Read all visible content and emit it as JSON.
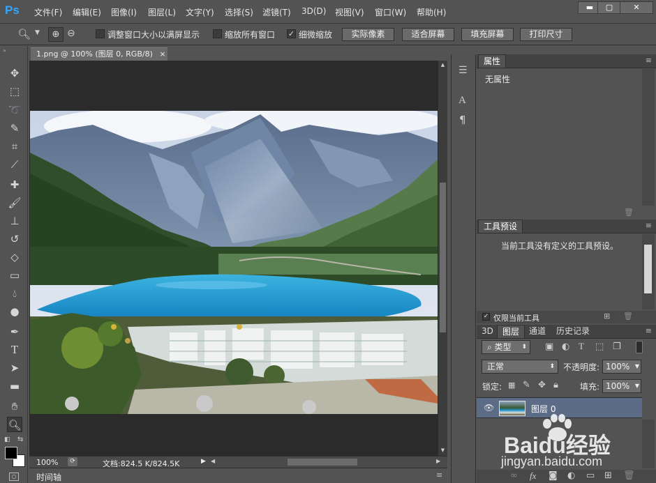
{
  "app": {
    "logo": "Ps"
  },
  "menu": [
    "文件(F)",
    "编辑(E)",
    "图像(I)",
    "图层(L)",
    "文字(Y)",
    "选择(S)",
    "滤镜(T)",
    "3D(D)",
    "视图(V)",
    "窗口(W)",
    "帮助(H)"
  ],
  "window_controls": {
    "minimize": "▬",
    "maximize": "▢",
    "close": "✕"
  },
  "options": {
    "resize_windows": "调整窗口大小以满屏显示",
    "zoom_all_windows": "缩放所有窗口",
    "scrubby_zoom": "细微缩放",
    "scrubby_zoom_checked": "✓",
    "actual_pixels": "实际像素",
    "fit_screen": "适合屏幕",
    "fill_screen": "填充屏幕",
    "print_size": "打印尺寸"
  },
  "document": {
    "tab_title": "1.png @ 100% (图层 0, RGB/8)",
    "close": "×"
  },
  "status": {
    "zoom": "100%",
    "doc_info": "文档:824.5 K/824.5K"
  },
  "timeline": {
    "label": "时间轴"
  },
  "properties": {
    "title": "属性",
    "content": "无属性"
  },
  "tool_presets": {
    "title": "工具预设",
    "message": "当前工具没有定义的工具预设。",
    "current_tool_only": "仅限当前工具",
    "checked": "✓"
  },
  "layers_tabs": [
    "3D",
    "图层",
    "通道",
    "历史记录"
  ],
  "layers": {
    "filter_type": "类型",
    "blend_mode": "正常",
    "opacity_label": "不透明度:",
    "opacity_value": "100%",
    "lock_label": "锁定:",
    "fill_label": "填充:",
    "fill_value": "100%",
    "items": [
      {
        "name": "图层 0",
        "visible": true
      }
    ]
  },
  "watermark": {
    "brand": "Baidu经验",
    "url": "jingyan.baidu.com"
  },
  "colors": {
    "accent": "#31a8ff",
    "selected_layer": "#5d6c86",
    "lake": "#1c8fc8"
  }
}
